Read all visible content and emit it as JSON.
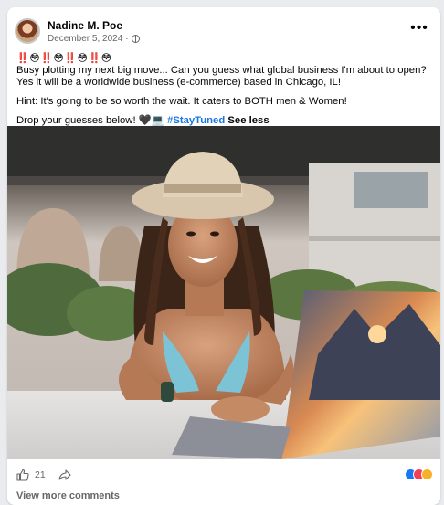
{
  "post": {
    "author": "Nadine M. Poe",
    "date": "December 5, 2024",
    "separator": "·",
    "more_label": "•••",
    "emoji_line": "‼️😳‼️😳‼️😳‼️😳",
    "body": "Busy plotting my next big move... Can you guess what global business I'm about to open? Yes it will be a worldwide business (e-commerce) based in Chicago, IL!",
    "hint": "Hint: It's going to be so worth the wait. It caters to BOTH men & Women!",
    "cta": "Drop your guesses below! 🖤💻",
    "hashtag": "#StayTuned",
    "see_less": "See less"
  },
  "engagement": {
    "like_count": "21",
    "reactions": [
      "like",
      "love",
      "care"
    ]
  },
  "comments": {
    "view_more_label": "View more comments"
  },
  "icons": {
    "privacy": "globe-icon",
    "like": "thumbs-up-icon",
    "share": "share-arrow-icon",
    "more": "more-options-icon"
  },
  "colors": {
    "link": "#1b74e4",
    "secondary_text": "#65676b",
    "like_blue": "#1877f2",
    "love_red": "#f33e58",
    "care_yellow": "#f7b125"
  }
}
